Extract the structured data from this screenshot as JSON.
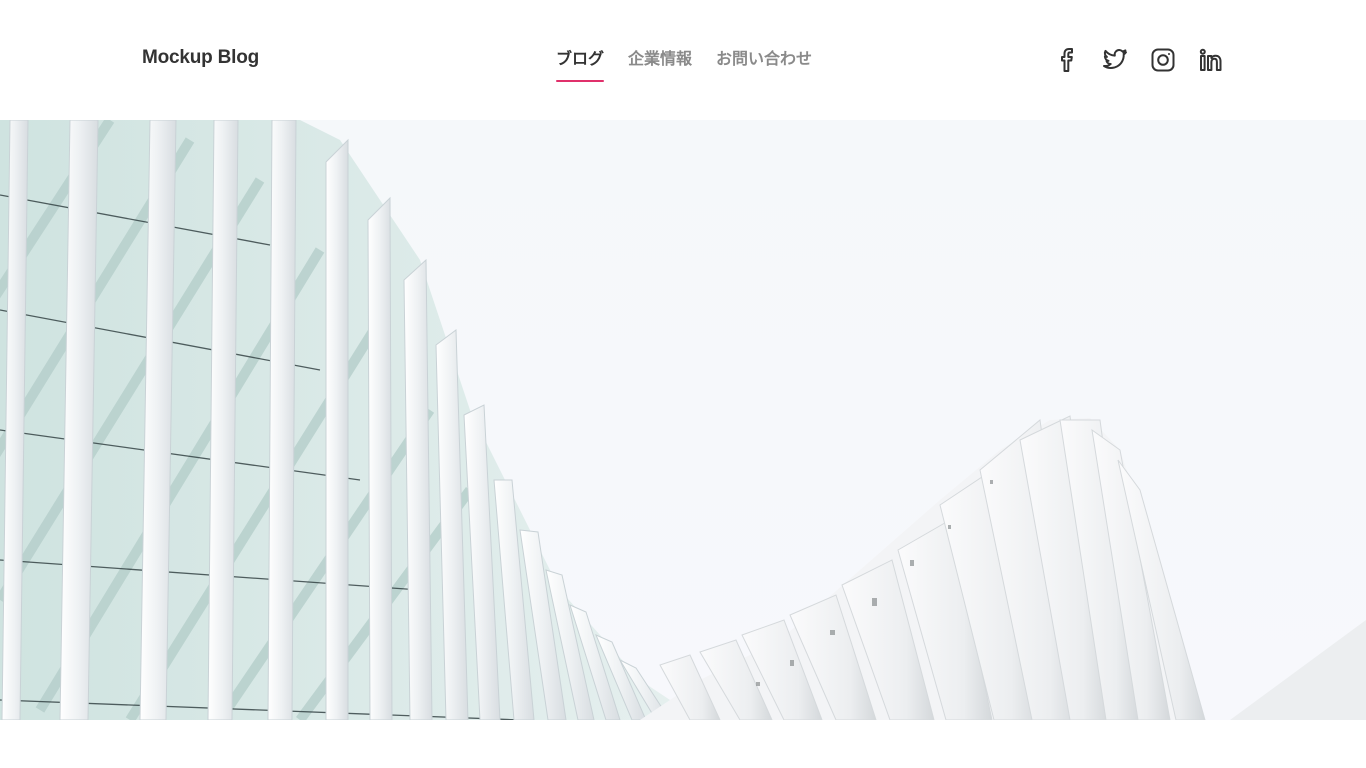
{
  "site": {
    "title": "Mockup Blog"
  },
  "nav": {
    "items": [
      {
        "label": "ブログ",
        "active": true
      },
      {
        "label": "企業情報",
        "active": false
      },
      {
        "label": "お問い合わせ",
        "active": false
      }
    ]
  },
  "social": {
    "icons": [
      "facebook-icon",
      "twitter-icon",
      "instagram-icon",
      "linkedin-icon"
    ]
  },
  "hero": {
    "image": "architecture-white-facade-photo"
  },
  "colors": {
    "accent": "#e0306b",
    "text_dark": "#333333",
    "text_muted": "#8a8a8a"
  }
}
